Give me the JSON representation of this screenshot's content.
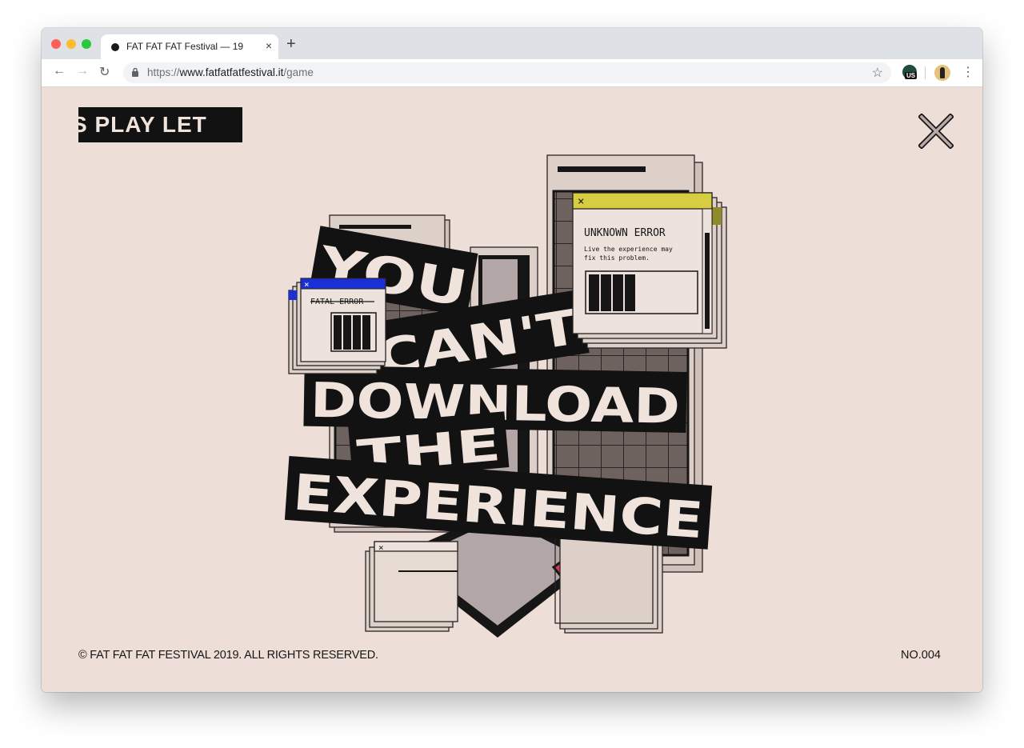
{
  "browser": {
    "tab_title": "FAT FAT FAT Festival — 19",
    "tab_close": "×",
    "new_tab": "+",
    "url_prefix": "https://",
    "url_host": "www.fatfatfatfestival.it",
    "url_path": "/game",
    "extension_badge": "US"
  },
  "page": {
    "ticker_text": "S PLAY   LET",
    "headline": [
      "YOU",
      "CAN'T",
      "DOWNLOAD",
      "THE",
      "EXPERIENCE"
    ],
    "error_big": {
      "title": "UNKNOWN ERROR",
      "message_line1": "Live the experience may",
      "message_line2": "fix this problem."
    },
    "error_small": {
      "title": "FATAL ERROR"
    },
    "window_close_glyph": "×",
    "footer_copyright": "© FAT FAT FAT FESTIVAL 2019. ALL RIGHTS RESERVED.",
    "footer_number": "NO.004"
  },
  "colors": {
    "background": "#eddfd7",
    "ink": "#121212",
    "yellow_titlebar": "#d6cd41",
    "blue_titlebar": "#1a2fd6",
    "pink_accent": "#d33a58",
    "grey_arrow": "#b3a6a6"
  }
}
